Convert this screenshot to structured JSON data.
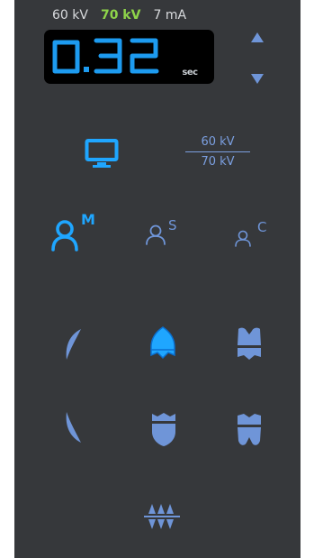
{
  "readout": {
    "kv_left": "60 kV",
    "kv_active": "70 kV",
    "ma": "7 mA"
  },
  "display": {
    "value": "0.32",
    "unit": "sec"
  },
  "kv_select": {
    "top": "60 kV",
    "bottom": "70 kV"
  },
  "patient_modes": [
    {
      "letter": "M",
      "selected": true
    },
    {
      "letter": "S",
      "selected": false
    },
    {
      "letter": "C",
      "selected": false
    }
  ],
  "tooth_buttons": [
    {
      "name": "upper-molar-left",
      "selected": false
    },
    {
      "name": "upper-incisor",
      "selected": true
    },
    {
      "name": "upper-molar-right",
      "selected": false
    },
    {
      "name": "lower-molar-left",
      "selected": false
    },
    {
      "name": "lower-incisor",
      "selected": false
    },
    {
      "name": "lower-molar-right",
      "selected": false
    },
    {
      "name": "bitewing",
      "selected": false
    }
  ],
  "colors": {
    "panel": "#36383b",
    "accent_active": "#1fa6ff",
    "accent": "#6f95d8",
    "kv_active": "#8ed44a",
    "display_digits": "#1d9bf0"
  }
}
